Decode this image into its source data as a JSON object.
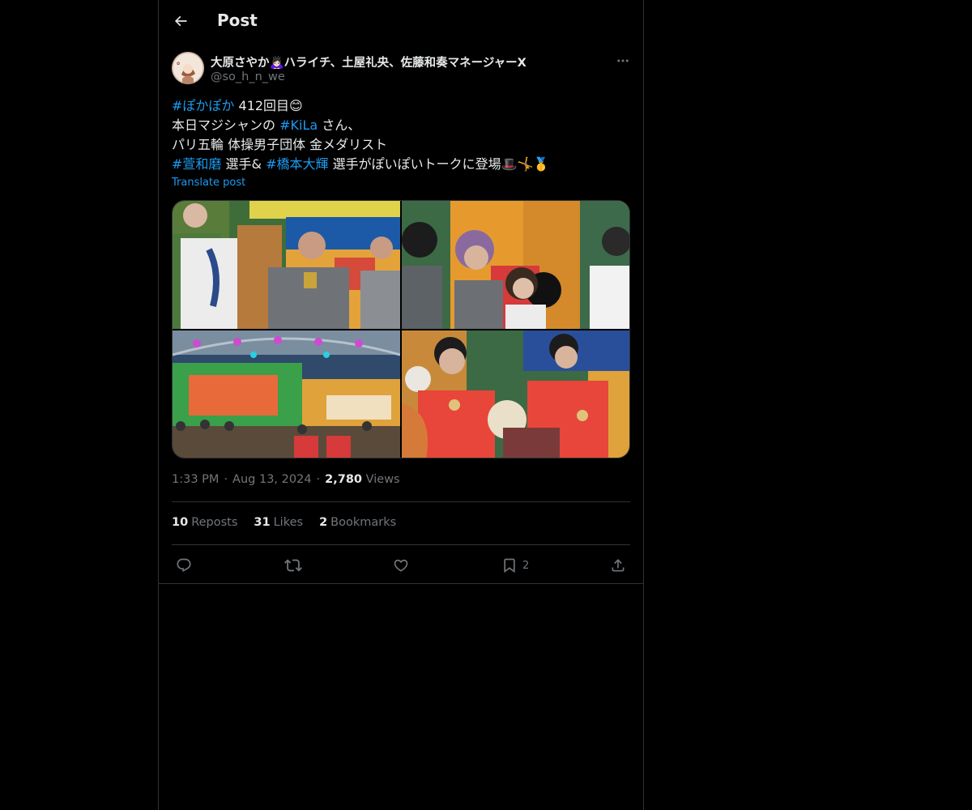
{
  "header": {
    "title": "Post",
    "back_icon": "arrow-left-icon"
  },
  "author": {
    "name": "大原さやか🙇🏻‍♀️ハライチ、土屋礼央、佐藤和奏マネージャーX",
    "handle": "@so_h_n_we",
    "avatar_icon": "avatar-image"
  },
  "tweet": {
    "lines": [
      {
        "tag": "#ぽかぽか",
        "text": " 412回目😊"
      },
      {
        "pre": "本日マジシャンの ",
        "tag": "#KiLa",
        "text": " さん、"
      },
      {
        "text": "パリ五輪 体操男子団体 金メダリスト"
      },
      {
        "tag": "#萱和磨",
        "mid": " 選手& ",
        "tag2": "#橋本大輝",
        "text": " 選手がぽいぽいトークに登場🎩🤸🥇"
      }
    ],
    "translate": "Translate post"
  },
  "media": {
    "photos": [
      {
        "alt": "photo-1"
      },
      {
        "alt": "photo-2"
      },
      {
        "alt": "photo-3"
      },
      {
        "alt": "photo-4"
      }
    ]
  },
  "meta": {
    "time": "1:33 PM",
    "date": "Aug 13, 2024",
    "views_count": "2,780",
    "views_label": "Views"
  },
  "stats": {
    "reposts_count": "10",
    "reposts_label": "Reposts",
    "likes_count": "31",
    "likes_label": "Likes",
    "bookmarks_count": "2",
    "bookmarks_label": "Bookmarks"
  },
  "actions": {
    "reply_icon": "reply-icon",
    "repost_icon": "repost-icon",
    "like_icon": "heart-icon",
    "bookmark_icon": "bookmark-icon",
    "bookmark_count": "2",
    "share_icon": "share-icon"
  },
  "colors": {
    "background": "#000000",
    "text": "#e7e9ea",
    "muted": "#71767b",
    "accent": "#1d9bf0",
    "border": "#2f3336"
  }
}
